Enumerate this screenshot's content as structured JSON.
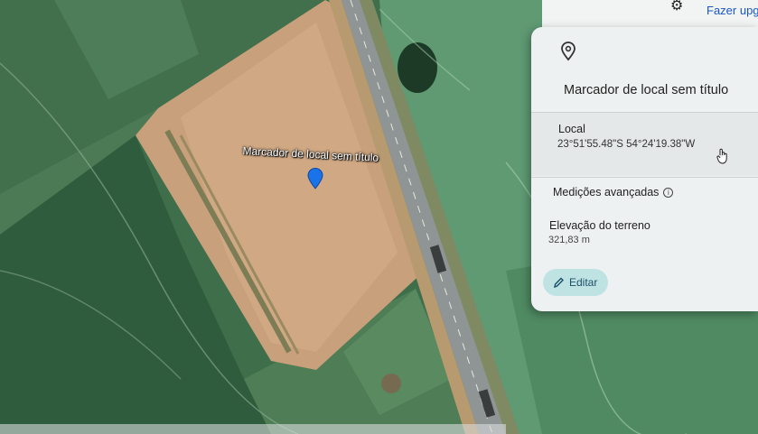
{
  "header": {
    "upgrade_label": "Fazer upgra",
    "gear_icon": "gear-icon"
  },
  "map": {
    "marker_label": "Marcador de local sem título",
    "pin_color": "#1a73e8"
  },
  "panel": {
    "title": "Marcador de local sem título",
    "location_label": "Local",
    "coordinates": "23°51'55.48\"S 54°24'19.38\"W",
    "advanced_label": "Medições avançadas",
    "elevation_label": "Elevação do terreno",
    "elevation_value": "321,83 m",
    "edit_label": "Editar",
    "icons": [
      "pin-icon",
      "info-icon",
      "pencil-icon",
      "hand-cursor-icon"
    ]
  }
}
